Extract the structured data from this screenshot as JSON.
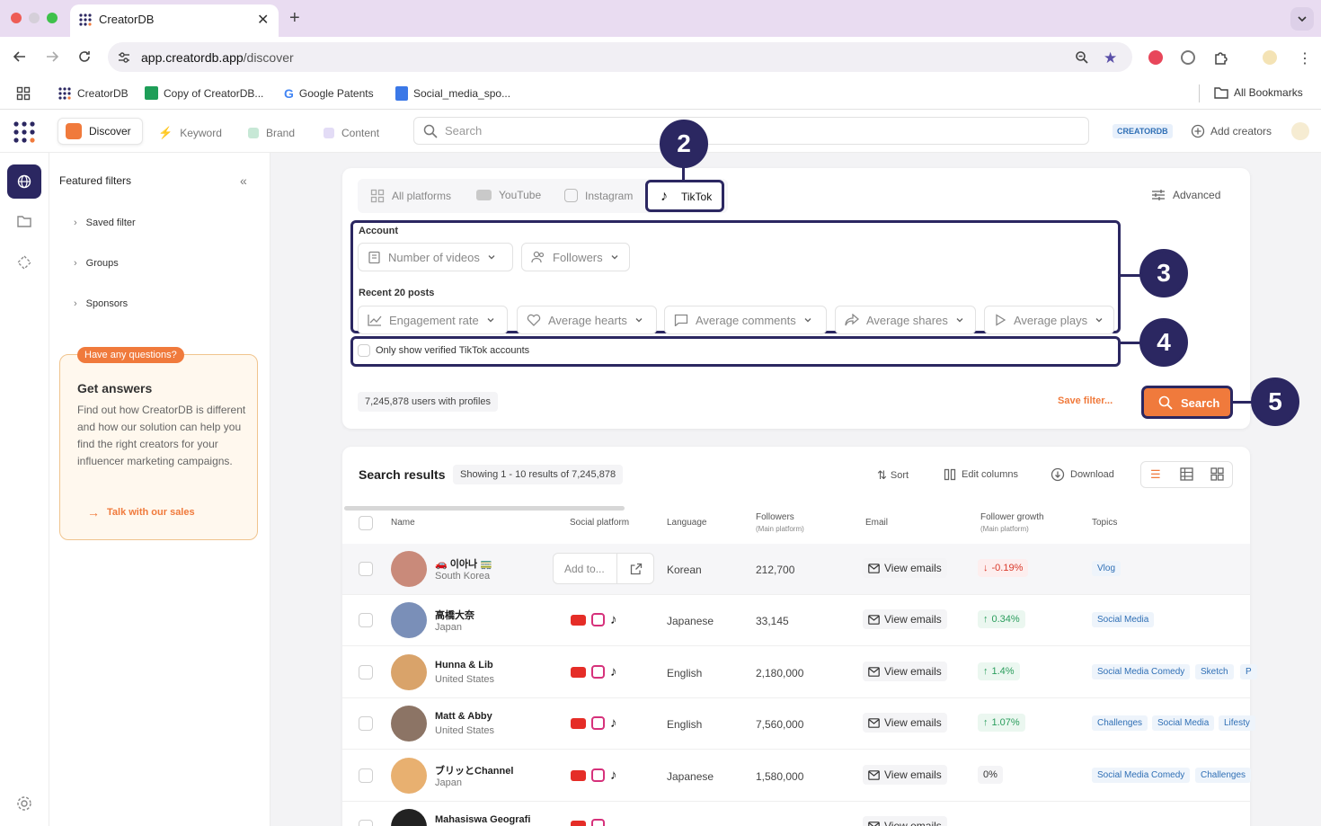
{
  "browser": {
    "tab_title": "CreatorDB",
    "url_host": "app.creatordb.app",
    "url_path": "/discover",
    "bookmarks": [
      "CreatorDB",
      "Copy of CreatorDB...",
      "Google Patents",
      "Social_media_spo..."
    ],
    "all_bookmarks": "All Bookmarks"
  },
  "header": {
    "tabs": [
      "Discover",
      "Keyword",
      "Brand",
      "Content"
    ],
    "search_placeholder": "Search",
    "brand_badge": "CREATORDB",
    "add_creators": "Add creators"
  },
  "sidebar": {
    "title": "Featured filters",
    "items": [
      "Saved filter",
      "Groups",
      "Sponsors"
    ],
    "help": {
      "tag": "Have any questions?",
      "title": "Get answers",
      "body": "Find out how CreatorDB is different and how our solution can help you find the right creators for your influencer marketing campaigns.",
      "cta": "Talk with our sales"
    }
  },
  "filters": {
    "platforms": [
      "All platforms",
      "YouTube",
      "Instagram",
      "TikTok"
    ],
    "advanced": "Advanced",
    "account_label": "Account",
    "account_filters": [
      "Number of videos",
      "Followers"
    ],
    "recent_label": "Recent 20 posts",
    "recent_filters": [
      "Engagement rate",
      "Average hearts",
      "Average comments",
      "Average shares",
      "Average plays"
    ],
    "verified_label": "Only show verified TikTok accounts",
    "users_count": "7,245,878 users with profiles",
    "save_filter": "Save filter...",
    "search_button": "Search"
  },
  "annotations": [
    "2",
    "3",
    "4",
    "5"
  ],
  "results": {
    "title": "Search results",
    "showing": "Showing 1 - 10 results of 7,245,878",
    "sort": "Sort",
    "edit_columns": "Edit columns",
    "download": "Download",
    "columns": {
      "name": "Name",
      "platform": "Social platform",
      "language": "Language",
      "followers": "Followers",
      "followers_sub": "(Main platform)",
      "email": "Email",
      "growth": "Follower growth",
      "growth_sub": "(Main platform)",
      "topics": "Topics"
    },
    "add_to": "Add to...",
    "view_emails": "View emails",
    "rows": [
      {
        "name": "🚗 이아나 🚃",
        "country": "South Korea",
        "language": "Korean",
        "followers": "212,700",
        "growth": "-0.19%",
        "trend": "down",
        "topics": [
          "Vlog"
        ],
        "avatar": "#c98a7a"
      },
      {
        "name": "高橋大奈",
        "country": "Japan",
        "language": "Japanese",
        "followers": "33,145",
        "growth": "0.34%",
        "trend": "up",
        "topics": [
          "Social Media"
        ],
        "avatar": "#7a8fb8"
      },
      {
        "name": "Hunna & Lib",
        "country": "United States",
        "language": "English",
        "followers": "2,180,000",
        "growth": "1.4%",
        "trend": "up",
        "topics": [
          "Social Media Comedy",
          "Sketch",
          "P"
        ],
        "avatar": "#d9a36a"
      },
      {
        "name": "Matt & Abby",
        "country": "United States",
        "language": "English",
        "followers": "7,560,000",
        "growth": "1.07%",
        "trend": "up",
        "topics": [
          "Challenges",
          "Social Media",
          "Lifesty"
        ],
        "avatar": "#8c7465"
      },
      {
        "name": "ブリッとChannel",
        "country": "Japan",
        "language": "Japanese",
        "followers": "1,580,000",
        "growth": "0%",
        "trend": "flat",
        "topics": [
          "Social Media Comedy",
          "Challenges"
        ],
        "avatar": "#e8b070"
      },
      {
        "name": "Mahasiswa Geografi",
        "country": "",
        "language": "",
        "followers": "",
        "growth": "",
        "trend": "flat",
        "topics": [],
        "avatar": "#222222"
      }
    ]
  },
  "colors": {
    "accent": "#f07a3c",
    "annotation": "#2b2761",
    "rail_active": "#2b2761",
    "growth_up": "#2a9d5c",
    "growth_down": "#d93a2b"
  }
}
